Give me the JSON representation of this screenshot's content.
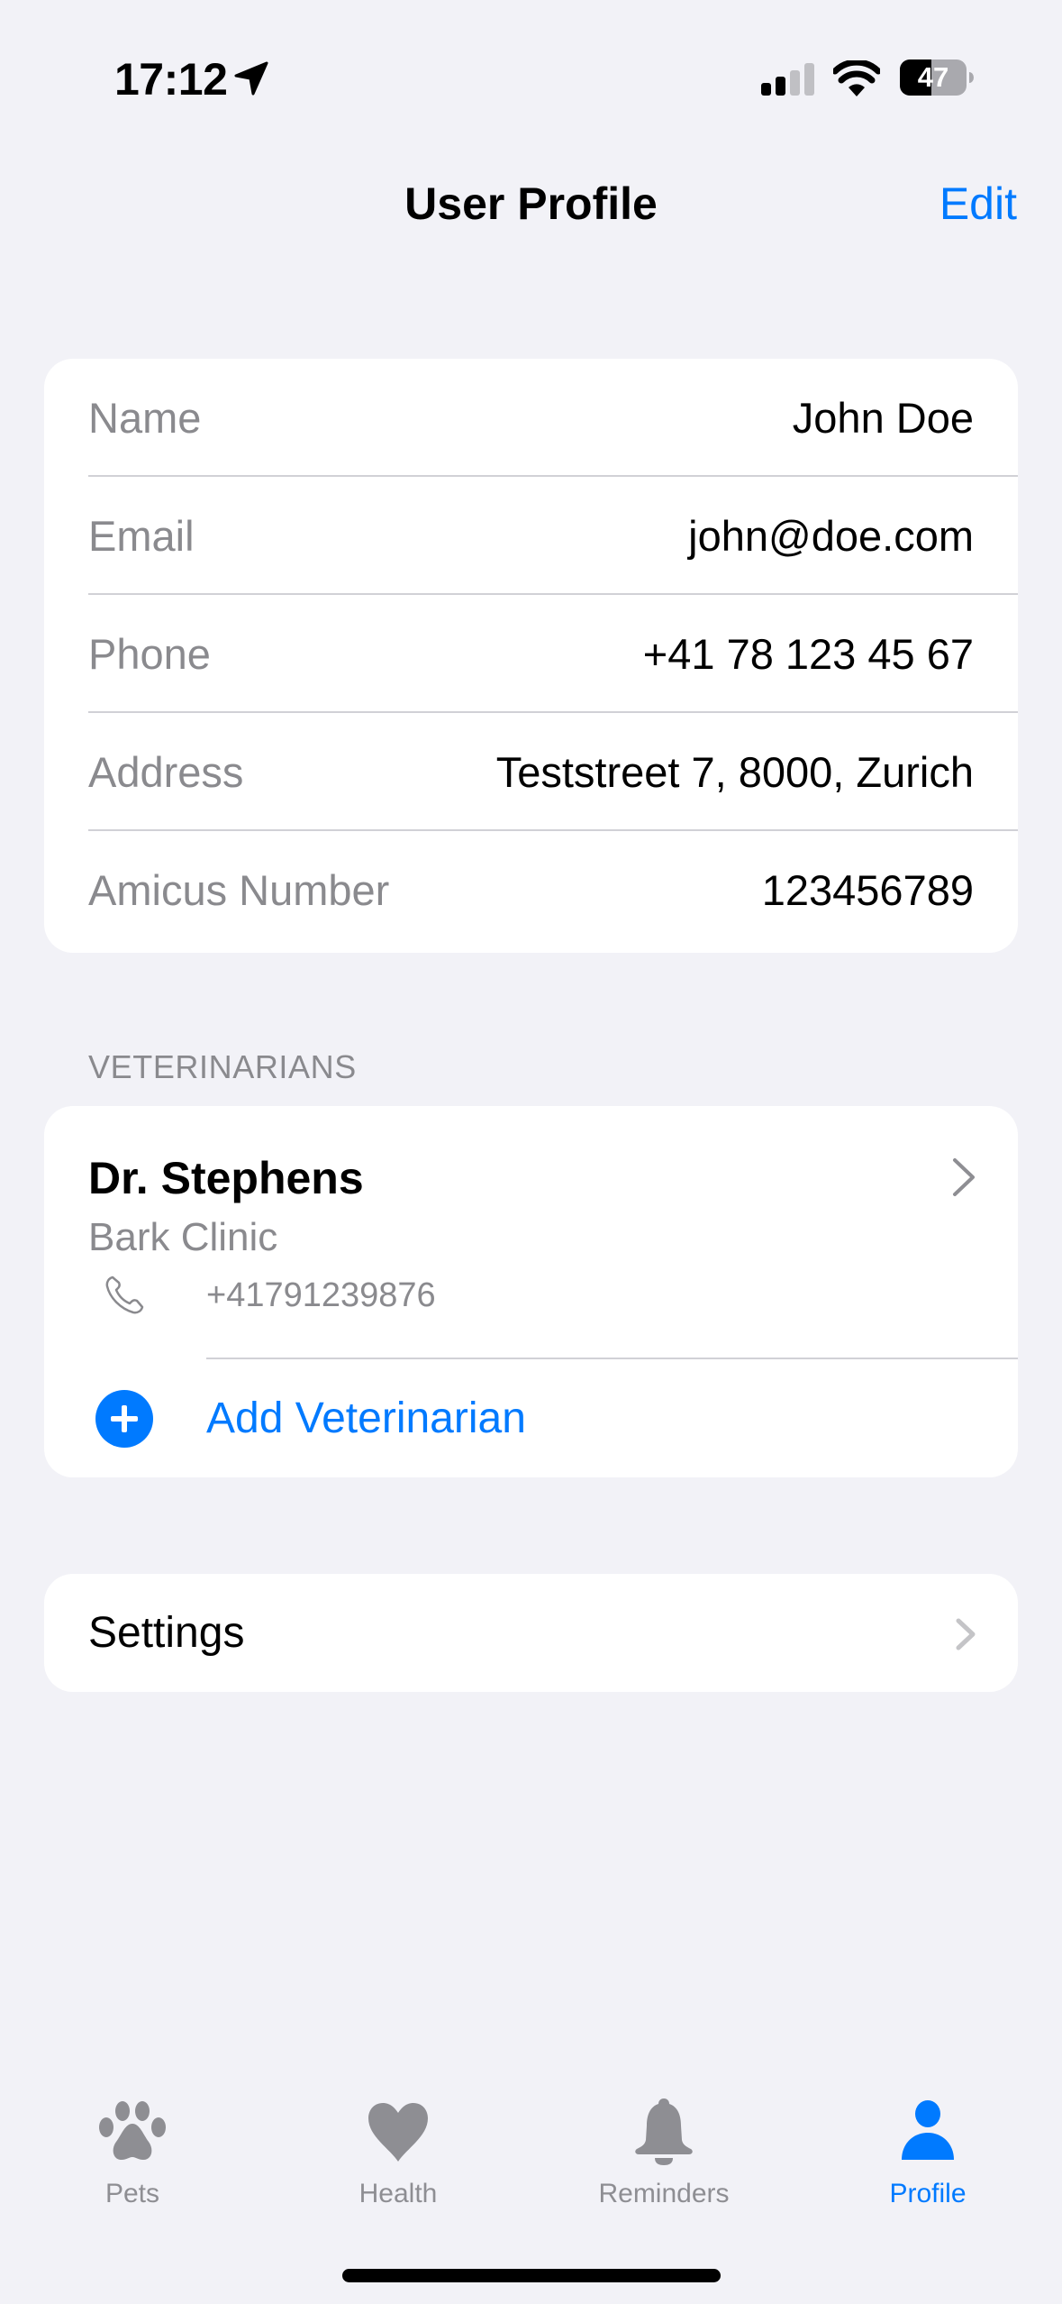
{
  "status_bar": {
    "time": "17:12",
    "location_icon": "location-arrow-icon",
    "signal_bars_active": 2,
    "signal_bars_total": 4,
    "wifi_icon": "wifi-icon",
    "battery_percent": "47"
  },
  "nav": {
    "title": "User Profile",
    "edit_label": "Edit"
  },
  "profile": {
    "rows": [
      {
        "label": "Name",
        "value": "John Doe"
      },
      {
        "label": "Email",
        "value": "john@doe.com"
      },
      {
        "label": "Phone",
        "value": "+41 78 123 45 67"
      },
      {
        "label": "Address",
        "value": "Teststreet 7, 8000, Zurich"
      },
      {
        "label": "Amicus Number",
        "value": "123456789"
      }
    ]
  },
  "veterinarians": {
    "header": "VETERINARIANS",
    "items": [
      {
        "name": "Dr. Stephens",
        "clinic": "Bark Clinic",
        "phone": "+41791239876",
        "phone_icon": "phone-icon",
        "chevron_icon": "chevron-right-icon"
      }
    ],
    "add_label": "Add Veterinarian",
    "add_icon": "plus-circle-icon"
  },
  "settings": {
    "label": "Settings",
    "chevron_icon": "chevron-right-icon"
  },
  "tab_bar": {
    "tabs": [
      {
        "label": "Pets",
        "icon": "paw-icon",
        "active": false
      },
      {
        "label": "Health",
        "icon": "heart-icon",
        "active": false
      },
      {
        "label": "Reminders",
        "icon": "bell-icon",
        "active": false
      },
      {
        "label": "Profile",
        "icon": "person-icon",
        "active": true
      }
    ]
  },
  "colors": {
    "accent": "#007aff",
    "background": "#f2f2f7",
    "secondary_text": "#8a8a8e",
    "inactive_tab": "#8e8e93",
    "separator": "#d1d1d6"
  }
}
